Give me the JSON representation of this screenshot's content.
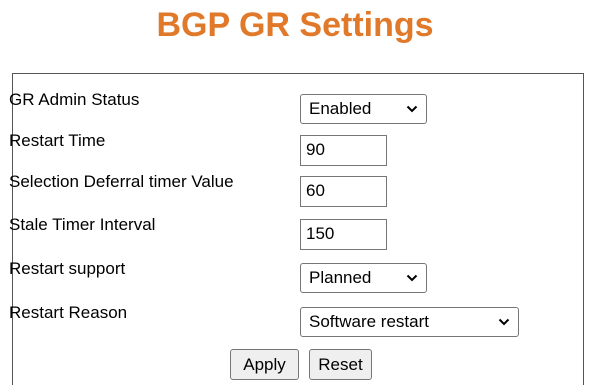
{
  "page": {
    "title": "BGP GR Settings"
  },
  "form": {
    "gr_admin_status": {
      "label": "GR Admin Status",
      "value": "Enabled"
    },
    "restart_time": {
      "label": "Restart Time",
      "value": "90"
    },
    "selection_deferral": {
      "label": "Selection Deferral timer Value",
      "value": "60"
    },
    "stale_timer": {
      "label": "Stale Timer Interval",
      "value": "150"
    },
    "restart_support": {
      "label": "Restart support",
      "value": "Planned"
    },
    "restart_reason": {
      "label": "Restart Reason",
      "value": "Software restart"
    }
  },
  "buttons": {
    "apply": "Apply",
    "reset": "Reset"
  },
  "colors": {
    "title": "#e0792a",
    "border": "#555555"
  },
  "icons": {
    "dropdown": "chevron-down-icon"
  }
}
